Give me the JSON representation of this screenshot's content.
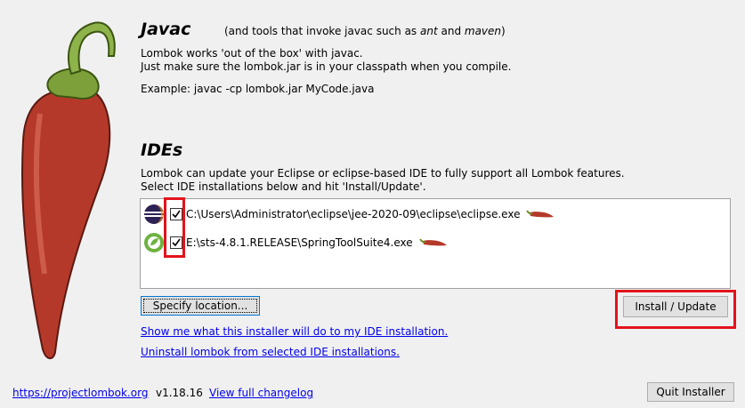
{
  "javac": {
    "title": "Javac",
    "note_prefix": "(and tools that invoke javac such as ",
    "note_ant": "ant",
    "note_and": " and ",
    "note_maven": "maven",
    "note_suffix": ")",
    "line1": "Lombok works 'out of the box' with javac.",
    "line2": "Just make sure the lombok.jar is in your classpath when you compile.",
    "example": "Example: javac -cp lombok.jar MyCode.java"
  },
  "ides": {
    "title": "IDEs",
    "line1": "Lombok can update your Eclipse or eclipse-based IDE to fully support all Lombok features.",
    "line2": "Select IDE installations below and hit 'Install/Update'.",
    "items": [
      {
        "path": "C:\\Users\\Administrator\\eclipse\\jee-2020-09\\eclipse\\eclipse.exe",
        "checked": true,
        "icon": "eclipse-icon"
      },
      {
        "path": "E:\\sts-4.8.1.RELEASE\\SpringToolSuite4.exe",
        "checked": true,
        "icon": "spring-tool-suite-icon"
      }
    ]
  },
  "buttons": {
    "specify": "Specify location...",
    "install": "Install / Update",
    "quit": "Quit Installer"
  },
  "links": {
    "show_me": "Show me what this installer will do to my IDE installation.",
    "uninstall": "Uninstall lombok from selected IDE installations.",
    "site": "https://projectlombok.org",
    "changelog": "View full changelog"
  },
  "version": "v1.18.16",
  "colors": {
    "highlight": "#e3131b",
    "link": "#0000ee",
    "pepper": "#b5392a",
    "stem": "#6b8e23"
  }
}
